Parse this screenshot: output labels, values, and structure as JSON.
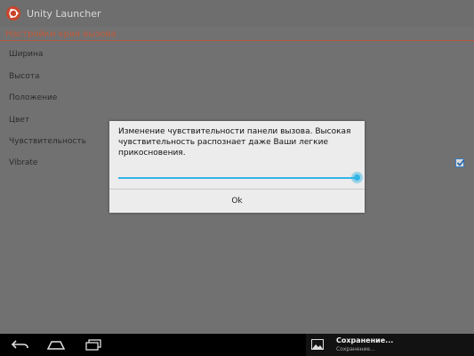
{
  "app": {
    "title": "Unity Launcher"
  },
  "section": {
    "title": "Настройки края вызова"
  },
  "preferences": [
    {
      "label": "Ширина"
    },
    {
      "label": "Высота"
    },
    {
      "label": "Положение"
    },
    {
      "label": "Цвет"
    },
    {
      "label": "Чувствительность"
    },
    {
      "label": "Vibrate",
      "checked": true
    }
  ],
  "dialog": {
    "message": "Изменение чувствительности панели вызова. Высокая чувствительность распознает даже Ваши легкие прикосновения.",
    "seek_value": 1.0,
    "ok_label": "Ok"
  },
  "notification": {
    "title": "Сохранение...",
    "subtitle": "Сохранение..."
  },
  "colors": {
    "accent": "#33b5e5",
    "section": "#c25a3a",
    "logo": "#c8452a"
  },
  "icons": {
    "logo": "ubuntu-logo-icon",
    "back": "back-icon",
    "home": "home-icon",
    "recents": "recent-apps-icon",
    "notification": "image-icon",
    "check": "checkmark-icon"
  }
}
